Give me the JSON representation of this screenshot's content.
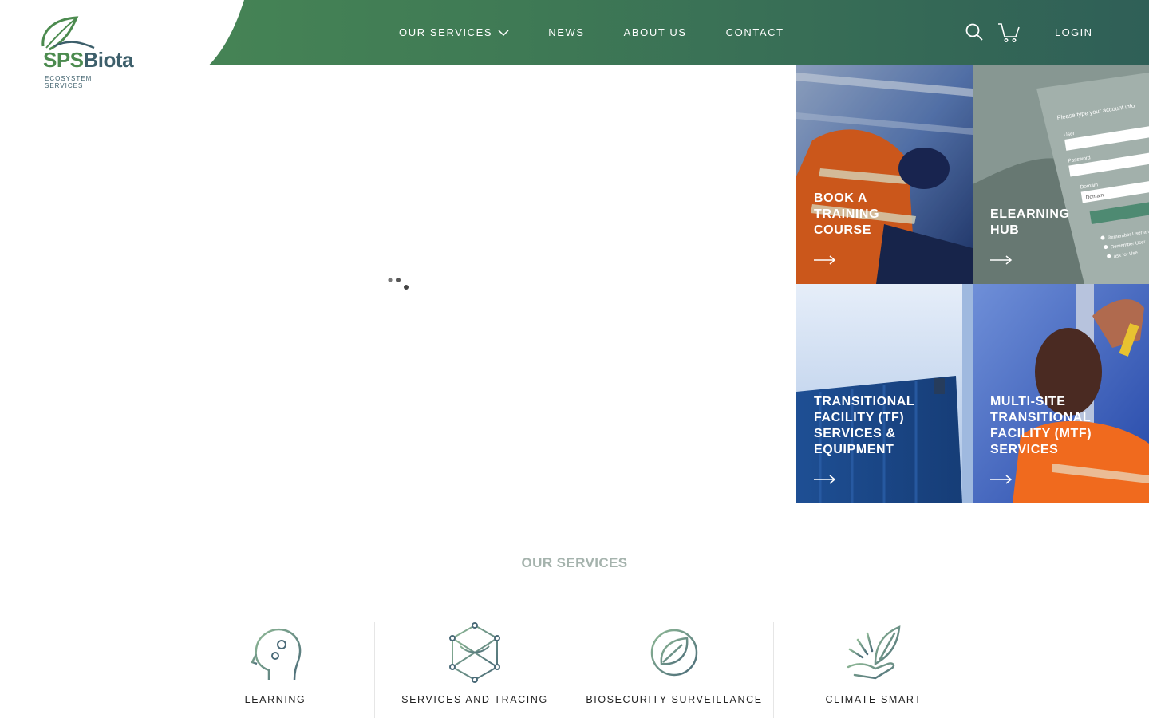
{
  "brand": {
    "name_part1": "SPS",
    "name_part2": "Biota",
    "tagline_line1": "ECOSYSTEM",
    "tagline_line2": "SERVICES",
    "colors": {
      "green": "#4c8b4f",
      "slate": "#3d5f6b",
      "header_start": "#4a8a55",
      "header_end": "#2f5f57"
    }
  },
  "nav": {
    "items": [
      {
        "label": "OUR SERVICES",
        "has_dropdown": true
      },
      {
        "label": "NEWS"
      },
      {
        "label": "ABOUT US"
      },
      {
        "label": "CONTACT"
      }
    ],
    "search_icon": "search-icon",
    "cart_icon": "cart-icon",
    "login_label": "LOGIN"
  },
  "tiles": [
    {
      "label": "BOOK A TRAINING COURSE",
      "lines": [
        "BOOK A",
        "TRAINING",
        "COURSE"
      ]
    },
    {
      "label": "ELEARNING HUB",
      "lines": [
        "ELEARNING",
        "HUB"
      ]
    },
    {
      "label": "TRANSITIONAL FACILITY (TF) SERVICES & EQUIPMENT",
      "lines": [
        "TRANSITIONAL",
        "FACILITY (TF)",
        "SERVICES &",
        "EQUIPMENT"
      ]
    },
    {
      "label": "MULTI-SITE TRANSITIONAL FACILITY (MTF) SERVICES",
      "lines": [
        "MULTI-SITE",
        "TRANSITIONAL",
        "FACILITY (MTF)",
        "SERVICES"
      ]
    }
  ],
  "elearning_form": {
    "heading": "Please type your account info",
    "user_label": "User",
    "password_label": "Password",
    "domain_label": "Domain",
    "domain_value": "Domain",
    "remember_1": "Remember User and",
    "remember_2": "Remember User",
    "remember_3": "ask for Use"
  },
  "services": {
    "title": "OUR SERVICES",
    "items": [
      {
        "label": "LEARNING",
        "icon": "head-gears-icon"
      },
      {
        "label": "SERVICES AND TRACING",
        "icon": "network-icon"
      },
      {
        "label": "BIOSECURITY SURVEILLANCE",
        "icon": "leaf-target-icon"
      },
      {
        "label": "CLIMATE SMART",
        "icon": "hand-plant-icon"
      }
    ]
  }
}
